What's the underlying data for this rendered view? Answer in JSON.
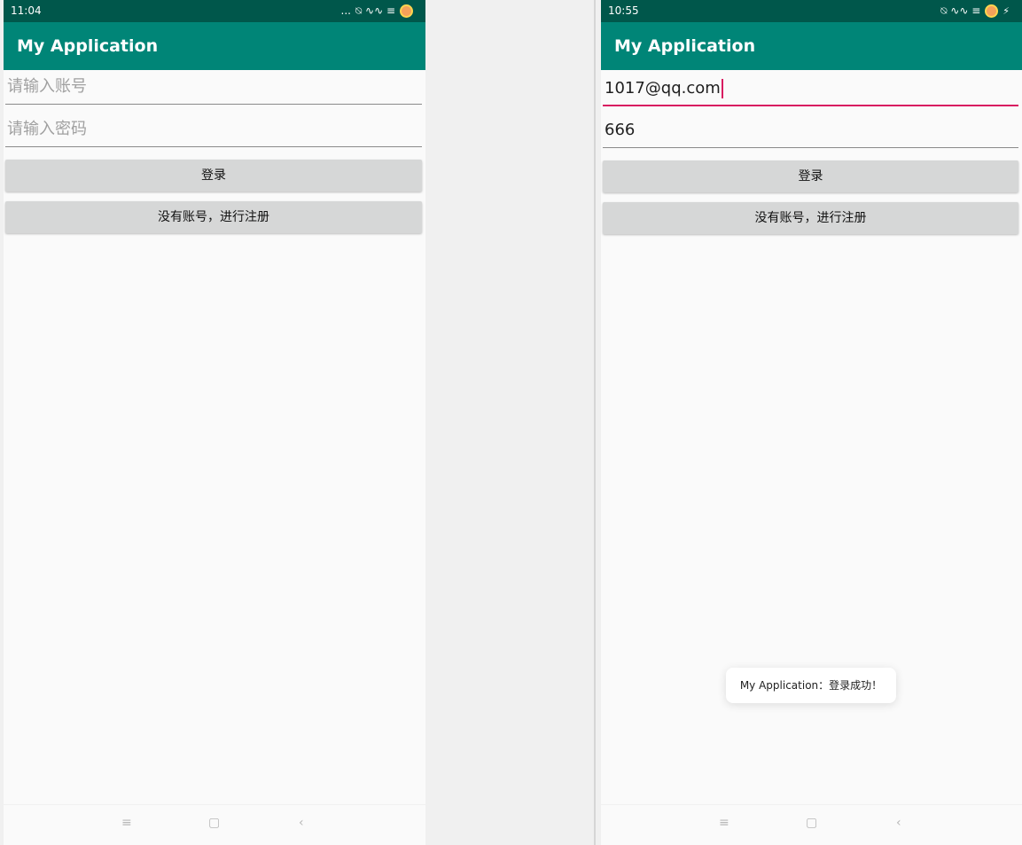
{
  "left_screen": {
    "status_bar": {
      "time": "11:04",
      "more": "...",
      "icons": "⍉ ∿∿ ≡"
    },
    "app_title": "My Application",
    "account_placeholder": "请输入账号",
    "password_placeholder": "请输入密码",
    "login_label": "登录",
    "register_label": "没有账号，进行注册",
    "nav": {
      "menu": "≡",
      "home": "▢",
      "back": "‹"
    }
  },
  "right_screen": {
    "status_bar": {
      "time": "10:55",
      "icons": "⍉ ∿∿ ≡",
      "charge": "⚡"
    },
    "app_title": "My Application",
    "account_value": "1017@qq.com",
    "password_value": "666",
    "login_label": "登录",
    "register_label": "没有账号，进行注册",
    "toast": "My Application：登录成功！",
    "nav": {
      "menu": "≡",
      "home": "▢",
      "back": "‹"
    }
  },
  "colors": {
    "status_bar": "#00574b",
    "app_bar": "#008577",
    "accent": "#d81b60",
    "button": "#d6d7d7"
  }
}
